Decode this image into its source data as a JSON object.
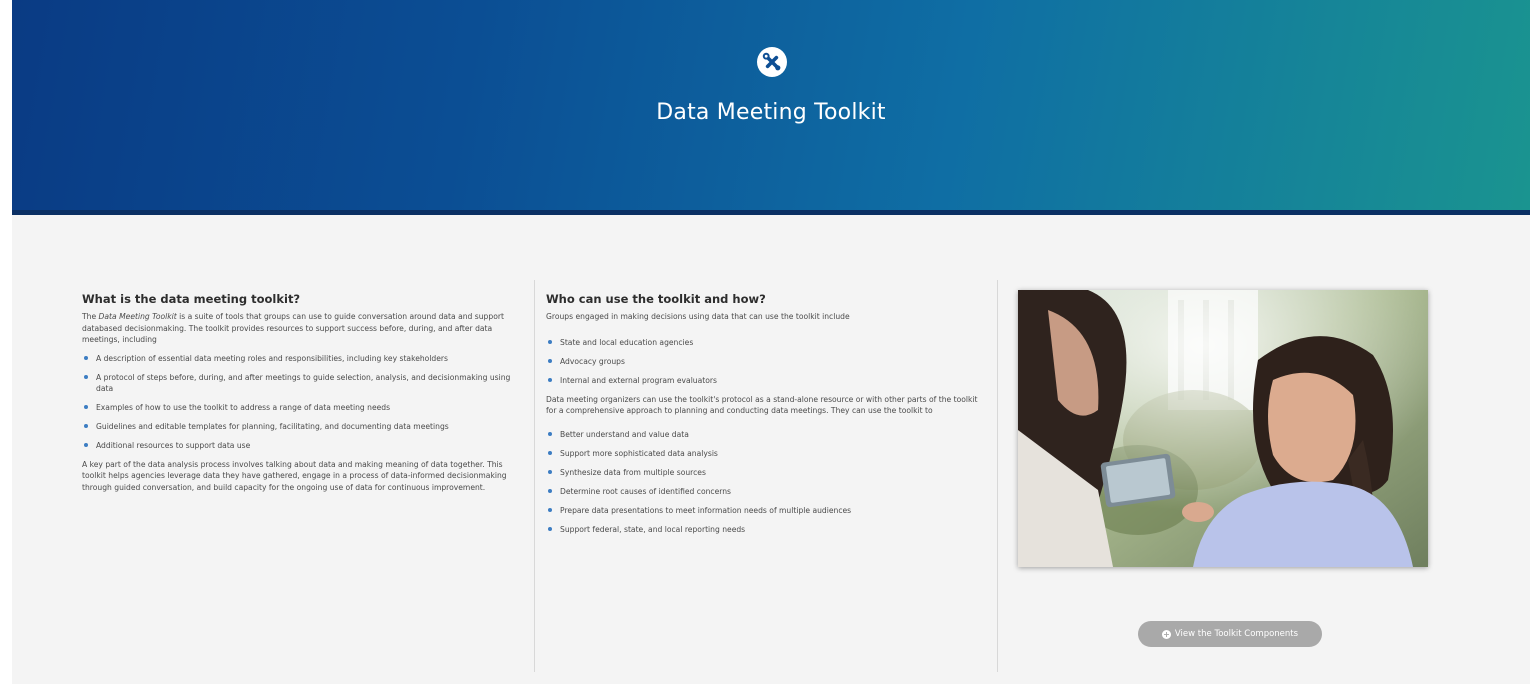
{
  "hero": {
    "title": "Data Meeting Toolkit",
    "icon": "tools-icon"
  },
  "col1": {
    "heading": "What is the data meeting toolkit?",
    "intro_italic": "Data Meeting Toolkit",
    "intro_pre": "The ",
    "intro_post": " is a suite of tools that groups can use to guide conversation around data and support databased decisionmaking. The toolkit provides resources to support success before, during, and after data meetings, including",
    "items": [
      "A description of essential data meeting roles and responsibilities, including key stakeholders",
      "A protocol of steps before, during, and after meetings to guide selection, analysis, and decisionmaking using data",
      "Examples of how to use the toolkit to address a range of data meeting needs",
      "Guidelines and editable templates for planning, facilitating, and documenting data meetings",
      "Additional resources to support data use"
    ],
    "closing": "A key part of the data analysis process involves talking about data and making meaning of data together. This toolkit helps agencies leverage data they have gathered, engage in a process of data-informed decisionmaking through guided conversation, and build capacity for the ongoing use of data for continuous improvement."
  },
  "col2": {
    "heading": "Who can use the toolkit and how?",
    "intro": "Groups engaged in making decisions using data that can use the toolkit include",
    "groups": [
      "State and local education agencies",
      "Advocacy groups",
      "Internal and external program evaluators"
    ],
    "middle": "Data meeting organizers can use the toolkit's protocol as a stand-alone resource or with other parts of the toolkit for a comprehensive approach to planning and conducting data meetings. They can use the toolkit to",
    "uses": [
      "Better understand and value data",
      "Support more sophisticated data analysis",
      "Synthesize data from multiple sources",
      "Determine root causes of identified concerns",
      "Prepare data presentations to meet information needs of multiple audiences",
      "Support federal, state, and local reporting needs"
    ]
  },
  "col3": {
    "button_label": "View the Toolkit Components",
    "button_icon": "plus-circle-icon"
  },
  "colors": {
    "hero_start": "#0a3b84",
    "hero_end": "#1a9490",
    "bullet": "#3c7dc2",
    "button": "#a9a9a9"
  }
}
